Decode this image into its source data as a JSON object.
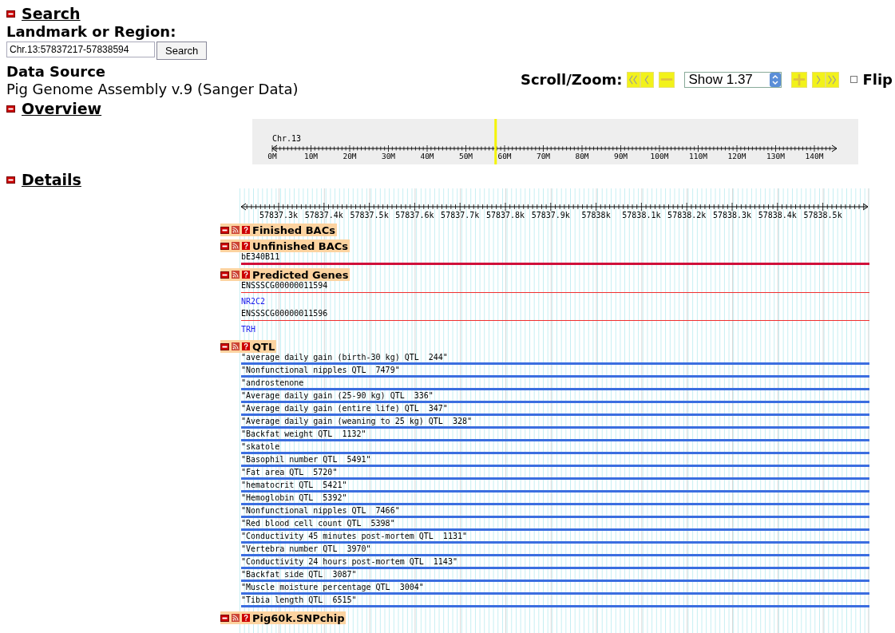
{
  "search": {
    "title": "Search",
    "expanded": true,
    "landmark_label": "Landmark or Region:",
    "landmark_value": "Chr.13:57837217-57838594",
    "button": "Search",
    "data_source_label": "Data Source",
    "data_source": "Pig Genome Assembly v.9 (Sanger Data)"
  },
  "scroll_zoom": {
    "label": "Scroll/Zoom:",
    "zoom_select": "Show 1.37",
    "flip_label": "Flip",
    "flip_checked": false
  },
  "overview": {
    "title": "Overview",
    "expanded": true,
    "chromosome": "Chr.13",
    "level": 0.395,
    "ticks": [
      "0M",
      "10M",
      "20M",
      "30M",
      "40M",
      "50M",
      "60M",
      "70M",
      "80M",
      "90M",
      "100M",
      "110M",
      "120M",
      "130M",
      "140M"
    ]
  },
  "details": {
    "title": "Details",
    "expanded": true,
    "ticks": [
      "57837.3k",
      "57837.4k",
      "57837.5k",
      "57837.6k",
      "57837.7k",
      "57837.8k",
      "57837.9k",
      "57838k",
      "57838.1k",
      "57838.2k",
      "57838.3k",
      "57838.4k",
      "57838.5k"
    ],
    "tracks": [
      {
        "title": "Finished BACs",
        "expanded": true
      },
      {
        "title": "Unfinished BACs",
        "expanded": true,
        "features": [
          {
            "kind": "bac",
            "label": "bE340B11"
          }
        ]
      },
      {
        "title": "Predicted Genes",
        "expanded": true,
        "features": [
          {
            "kind": "gene",
            "label": "ENSSSCG00000011594",
            "name": "NR2C2"
          },
          {
            "kind": "gene",
            "label": "ENSSSCG00000011596",
            "name": "TRH"
          }
        ]
      },
      {
        "title": "QTL",
        "expanded": true,
        "features": [
          {
            "kind": "qtl",
            "label": "\"average daily gain (birth-30 kg) QTL  244\""
          },
          {
            "kind": "qtl",
            "label": "\"Nonfunctional nipples QTL  7479\""
          },
          {
            "kind": "qtl",
            "label": "\"androstenone"
          },
          {
            "kind": "qtl",
            "label": "\"Average daily gain (25-90 kg) QTL  336\""
          },
          {
            "kind": "qtl",
            "label": "\"Average daily gain (entire life) QTL  347\""
          },
          {
            "kind": "qtl",
            "label": "\"Average daily gain (weaning to 25 kg) QTL  328\""
          },
          {
            "kind": "qtl",
            "label": "\"Backfat weight QTL  1132\""
          },
          {
            "kind": "qtl",
            "label": "\"skatole"
          },
          {
            "kind": "qtl",
            "label": "\"Basophil number QTL  5491\""
          },
          {
            "kind": "qtl",
            "label": "\"Fat area QTL  5720\""
          },
          {
            "kind": "qtl",
            "label": "\"hematocrit QTL  5421\""
          },
          {
            "kind": "qtl",
            "label": "\"Hemoglobin QTL  5392\""
          },
          {
            "kind": "qtl",
            "label": "\"Nonfunctional nipples QTL  7466\""
          },
          {
            "kind": "qtl",
            "label": "\"Red blood cell count QTL  5398\""
          },
          {
            "kind": "qtl",
            "label": "\"Conductivity 45 minutes post-mortem QTL  1131\""
          },
          {
            "kind": "qtl",
            "label": "\"Vertebra number QTL  3970\""
          },
          {
            "kind": "qtl",
            "label": "\"Conductivity 24 hours post-mortem QTL  1143\""
          },
          {
            "kind": "qtl",
            "label": "\"Backfat side QTL  3087\""
          },
          {
            "kind": "qtl",
            "label": "\"Muscle moisture percentage QTL  3004\""
          },
          {
            "kind": "qtl",
            "label": "\"Tibia length QTL  6515\""
          }
        ]
      },
      {
        "title": "Pig60k.SNPchip",
        "expanded": true
      }
    ]
  }
}
